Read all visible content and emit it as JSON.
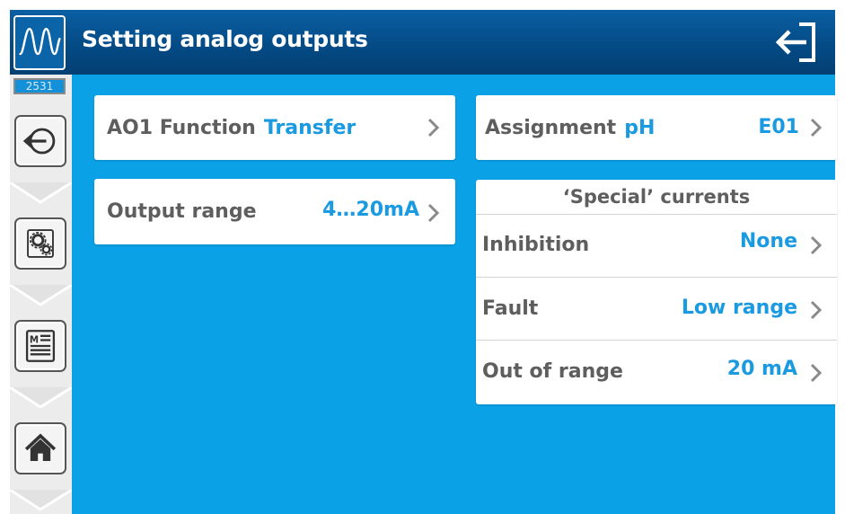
{
  "header": {
    "title": "Setting analog outputs",
    "logo_icon": "waveform-icon",
    "exit_icon": "exit-icon"
  },
  "sidebar": {
    "device_id": "2531",
    "buttons": [
      {
        "icon": "back-arrow-icon"
      },
      {
        "icon": "gears-icon"
      },
      {
        "icon": "menu-list-icon"
      },
      {
        "icon": "home-icon"
      }
    ]
  },
  "left_panel": {
    "function": {
      "label": "AO1 Function",
      "value": "Transfer"
    },
    "output_range": {
      "label": "Output range",
      "value": "4…20mA"
    }
  },
  "right_panel": {
    "assignment": {
      "label": "Assignment",
      "value": "pH",
      "channel": "E01"
    },
    "special_currents": {
      "title": "‘Special’ currents",
      "rows": [
        {
          "label": "Inhibition",
          "value": "None"
        },
        {
          "label": "Fault",
          "value": "Low range"
        },
        {
          "label": "Out of range",
          "value": "20 mA"
        }
      ]
    }
  },
  "colors": {
    "header": "#044b86",
    "background": "#0aa1e6",
    "accent_value": "#1a9ae0",
    "label_text": "#5e5e5e"
  }
}
